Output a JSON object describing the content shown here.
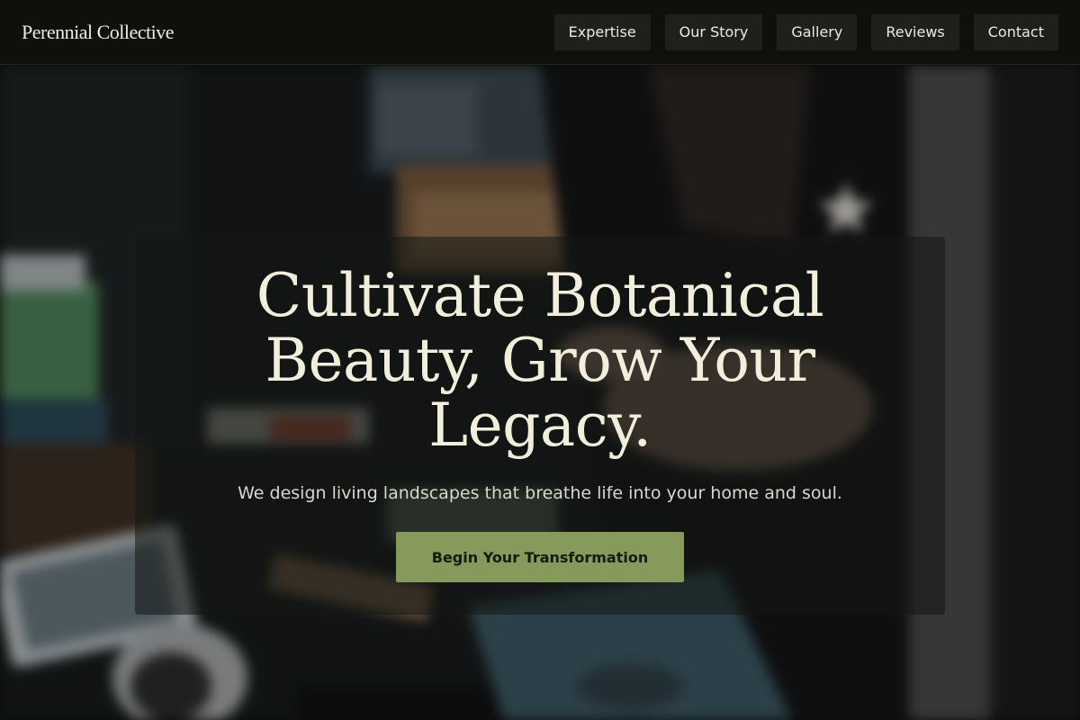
{
  "header": {
    "brand": "Perennial Collective",
    "nav": [
      {
        "label": "Expertise"
      },
      {
        "label": "Our Story"
      },
      {
        "label": "Gallery"
      },
      {
        "label": "Reviews"
      },
      {
        "label": "Contact"
      }
    ]
  },
  "hero": {
    "title": "Cultivate Botanical Beauty, Grow Your Legacy.",
    "subtitle": "We design living landscapes that breathe life into your home and soul.",
    "cta_label": "Begin Your Transformation"
  },
  "colors": {
    "header_bg": "#0e100c",
    "nav_bg": "#1e201b",
    "accent": "#869a5c",
    "title": "#f1eedb"
  }
}
